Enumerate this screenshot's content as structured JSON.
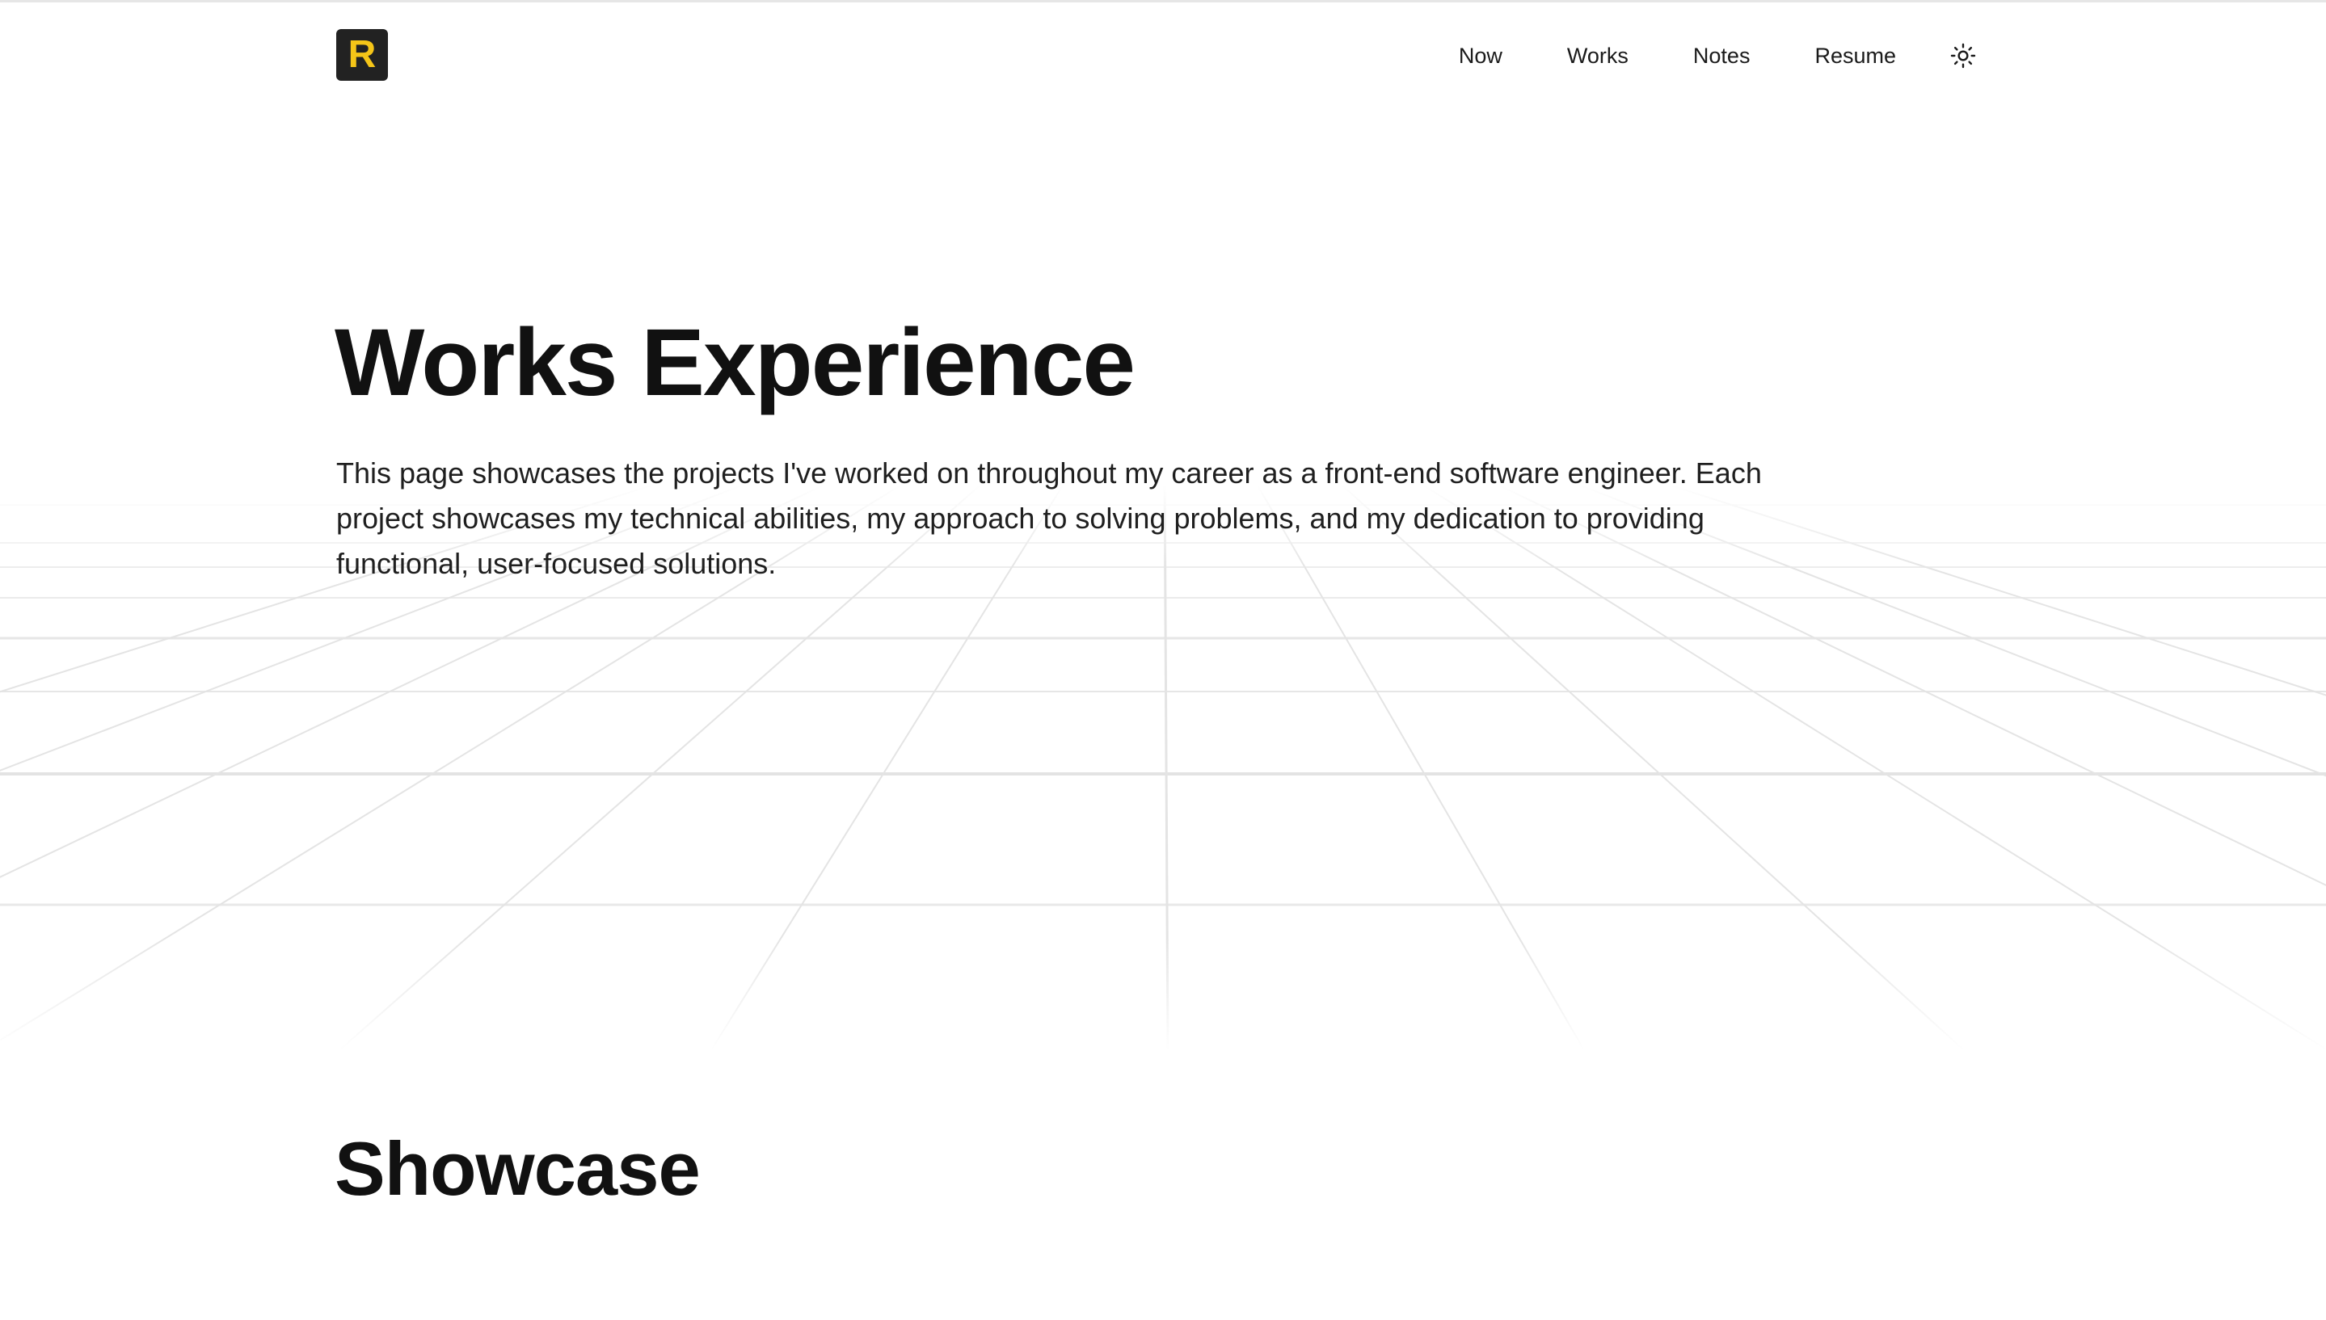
{
  "header": {
    "logo_letter": "R",
    "nav": {
      "now": "Now",
      "works": "Works",
      "notes": "Notes",
      "resume": "Resume"
    },
    "theme_toggle_icon": "sun-icon"
  },
  "hero": {
    "title": "Works Experience",
    "description": "This page showcases the projects I've worked on throughout my career as a front-end software engineer. Each project showcases my technical abilities, my approach to solving problems, and my dedication to providing functional, user-focused solutions."
  },
  "showcase": {
    "title": "Showcase"
  },
  "colors": {
    "logo_bg": "#222222",
    "logo_letter": "#f5c518",
    "text": "#111111",
    "grid_line": "#e8e8e8"
  }
}
